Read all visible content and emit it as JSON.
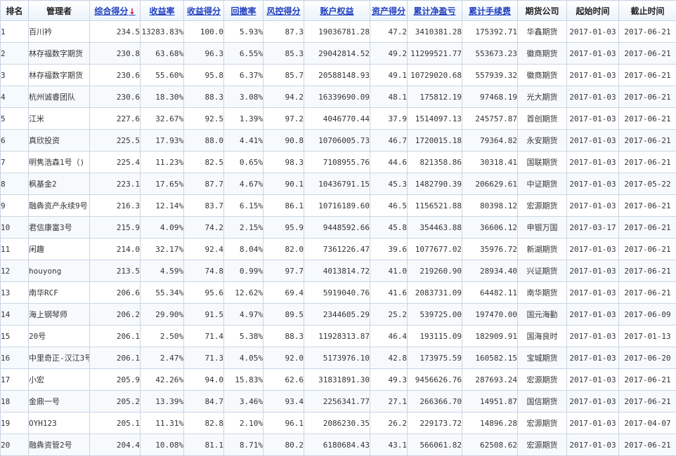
{
  "columns": [
    {
      "label": "排名",
      "sortable": false
    },
    {
      "label": "管理者",
      "sortable": false
    },
    {
      "label": "综合得分",
      "sortable": true,
      "sorted": true
    },
    {
      "label": "收益率",
      "sortable": true
    },
    {
      "label": "收益得分",
      "sortable": true
    },
    {
      "label": "回撤率",
      "sortable": true
    },
    {
      "label": "风控得分",
      "sortable": true
    },
    {
      "label": "账户权益",
      "sortable": true
    },
    {
      "label": "资产得分",
      "sortable": true
    },
    {
      "label": "累计净盈亏",
      "sortable": true
    },
    {
      "label": "累计手续费",
      "sortable": true
    },
    {
      "label": "期货公司",
      "sortable": false
    },
    {
      "label": "起始时间",
      "sortable": false
    },
    {
      "label": "截止时间",
      "sortable": false
    }
  ],
  "sort_arrow": "↓",
  "colors": {
    "header_link": "#1f3fbf",
    "profit_red": "#c81414",
    "sort_arrow": "#d40000",
    "border": "#c9d6e3"
  },
  "rows": [
    [
      "1",
      "百川衿",
      "234.5",
      "13283.83%",
      "100.0",
      "5.93%",
      "87.3",
      "19036781.28",
      "47.2",
      "3410381.28",
      "175392.71",
      "华鑫期货",
      "2017-01-03",
      "2017-06-21"
    ],
    [
      "2",
      "林存福数字期货",
      "230.8",
      "63.68%",
      "96.3",
      "6.55%",
      "85.3",
      "29042814.52",
      "49.2",
      "11299521.77",
      "553673.23",
      "徽商期货",
      "2017-01-03",
      "2017-06-21"
    ],
    [
      "3",
      "林存福数字期货",
      "230.6",
      "55.60%",
      "95.8",
      "6.37%",
      "85.7",
      "20588148.93",
      "49.1",
      "10729020.68",
      "557939.32",
      "徽商期货",
      "2017-01-03",
      "2017-06-21"
    ],
    [
      "4",
      "杭州诚睿团队",
      "230.6",
      "18.30%",
      "88.3",
      "3.08%",
      "94.2",
      "16339690.09",
      "48.1",
      "175812.19",
      "97468.19",
      "光大期货",
      "2017-01-03",
      "2017-06-21"
    ],
    [
      "5",
      "江米",
      "227.6",
      "32.67%",
      "92.5",
      "1.39%",
      "97.2",
      "4046770.44",
      "37.9",
      "1514097.13",
      "245757.87",
      "首创期货",
      "2017-01-03",
      "2017-06-21"
    ],
    [
      "6",
      "真欣投资",
      "225.5",
      "17.93%",
      "88.0",
      "4.41%",
      "90.8",
      "10706005.73",
      "46.7",
      "1720015.18",
      "79364.82",
      "永安期货",
      "2017-01-03",
      "2017-06-21"
    ],
    [
      "7",
      "明隽浩森1号（)",
      "225.4",
      "11.23%",
      "82.5",
      "0.65%",
      "98.3",
      "7108955.76",
      "44.6",
      "821358.86",
      "30318.41",
      "国联期货",
      "2017-01-03",
      "2017-06-21"
    ],
    [
      "8",
      "枫基金2",
      "223.1",
      "17.65%",
      "87.7",
      "4.67%",
      "90.1",
      "10436791.15",
      "45.3",
      "1482790.39",
      "206629.61",
      "中证期货",
      "2017-01-03",
      "2017-05-22"
    ],
    [
      "9",
      "融犇资产永续9号",
      "216.3",
      "12.14%",
      "83.7",
      "6.15%",
      "86.1",
      "10716189.60",
      "46.5",
      "1156521.88",
      "80398.12",
      "宏源期货",
      "2017-01-03",
      "2017-06-21"
    ],
    [
      "10",
      "君信康富3号",
      "215.9",
      "4.09%",
      "74.2",
      "2.15%",
      "95.9",
      "9448592.66",
      "45.8",
      "354463.88",
      "36606.12",
      "申银万国",
      "2017-03-17",
      "2017-06-21"
    ],
    [
      "11",
      "闲趣",
      "214.0",
      "32.17%",
      "92.4",
      "8.04%",
      "82.0",
      "7361226.47",
      "39.6",
      "1077677.02",
      "35976.72",
      "新湖期货",
      "2017-01-03",
      "2017-06-21"
    ],
    [
      "12",
      "houyong",
      "213.5",
      "4.59%",
      "74.8",
      "0.99%",
      "97.7",
      "4013814.72",
      "41.0",
      "219260.90",
      "28934.40",
      "兴证期货",
      "2017-01-03",
      "2017-06-21"
    ],
    [
      "13",
      "南华RCF",
      "206.6",
      "55.34%",
      "95.6",
      "12.62%",
      "69.4",
      "5919040.76",
      "41.6",
      "2083731.09",
      "64482.11",
      "南华期货",
      "2017-01-03",
      "2017-06-21"
    ],
    [
      "14",
      "海上钢琴师",
      "206.2",
      "29.90%",
      "91.5",
      "4.97%",
      "89.5",
      "2344605.29",
      "25.2",
      "539725.00",
      "197470.00",
      "国元海勤",
      "2017-01-03",
      "2017-06-09"
    ],
    [
      "15",
      "20号",
      "206.1",
      "2.50%",
      "71.4",
      "5.38%",
      "88.3",
      "11928313.87",
      "46.4",
      "193115.09",
      "182909.91",
      "国海良时",
      "2017-01-03",
      "2017-01-13"
    ],
    [
      "16",
      "中里奇正-汉江3号",
      "206.1",
      "2.47%",
      "71.3",
      "4.05%",
      "92.0",
      "5173976.10",
      "42.8",
      "173975.59",
      "160582.15",
      "宝城期货",
      "2017-01-03",
      "2017-06-20"
    ],
    [
      "17",
      "小宏",
      "205.9",
      "42.26%",
      "94.0",
      "15.83%",
      "62.6",
      "31831891.30",
      "49.3",
      "9456626.76",
      "287693.24",
      "宏源期货",
      "2017-01-03",
      "2017-06-21"
    ],
    [
      "18",
      "金鼎一号",
      "205.2",
      "13.39%",
      "84.7",
      "3.46%",
      "93.4",
      "2256341.77",
      "27.1",
      "266366.70",
      "14951.87",
      "国信期货",
      "2017-01-03",
      "2017-06-21"
    ],
    [
      "19",
      "OYH123",
      "205.1",
      "11.31%",
      "82.8",
      "2.10%",
      "96.1",
      "2086230.35",
      "26.2",
      "229173.72",
      "14896.28",
      "宏源期货",
      "2017-01-03",
      "2017-04-07"
    ],
    [
      "20",
      "融犇资管2号",
      "204.4",
      "10.08%",
      "81.1",
      "8.71%",
      "80.2",
      "6180684.43",
      "43.1",
      "566061.82",
      "62508.62",
      "宏源期货",
      "2017-01-03",
      "2017-06-21"
    ]
  ]
}
